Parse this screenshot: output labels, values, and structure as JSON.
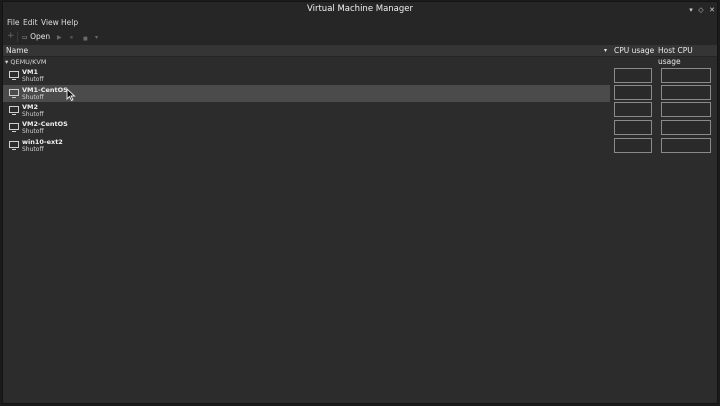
{
  "window": {
    "title": "Virtual Machine Manager"
  },
  "window_controls": {
    "minimize": "▾",
    "maximize": "◇",
    "close": "✕"
  },
  "menu": {
    "items": [
      "File",
      "Edit",
      "View",
      "Help"
    ]
  },
  "toolbar": {
    "new_glyph": "+",
    "open_label": "Open",
    "run_glyph": "▶",
    "pause_glyph": "⏸",
    "stop_glyph": "■",
    "more_glyph": "▾"
  },
  "columns": {
    "name": "Name",
    "sort_glyph": "▾",
    "cpu": "CPU usage",
    "host_cpu": "Host CPU usage"
  },
  "group": {
    "expander": "▾",
    "label": "QEMU/KVM"
  },
  "vms": [
    {
      "name": "VM1",
      "state": "Shutoff",
      "selected": false
    },
    {
      "name": "VM1-CentOS",
      "state": "Shutoff",
      "selected": true
    },
    {
      "name": "VM2",
      "state": "Shutoff",
      "selected": false
    },
    {
      "name": "VM2-CentOS",
      "state": "Shutoff",
      "selected": false
    },
    {
      "name": "win10-ext2",
      "state": "Shutoff",
      "selected": false
    }
  ]
}
